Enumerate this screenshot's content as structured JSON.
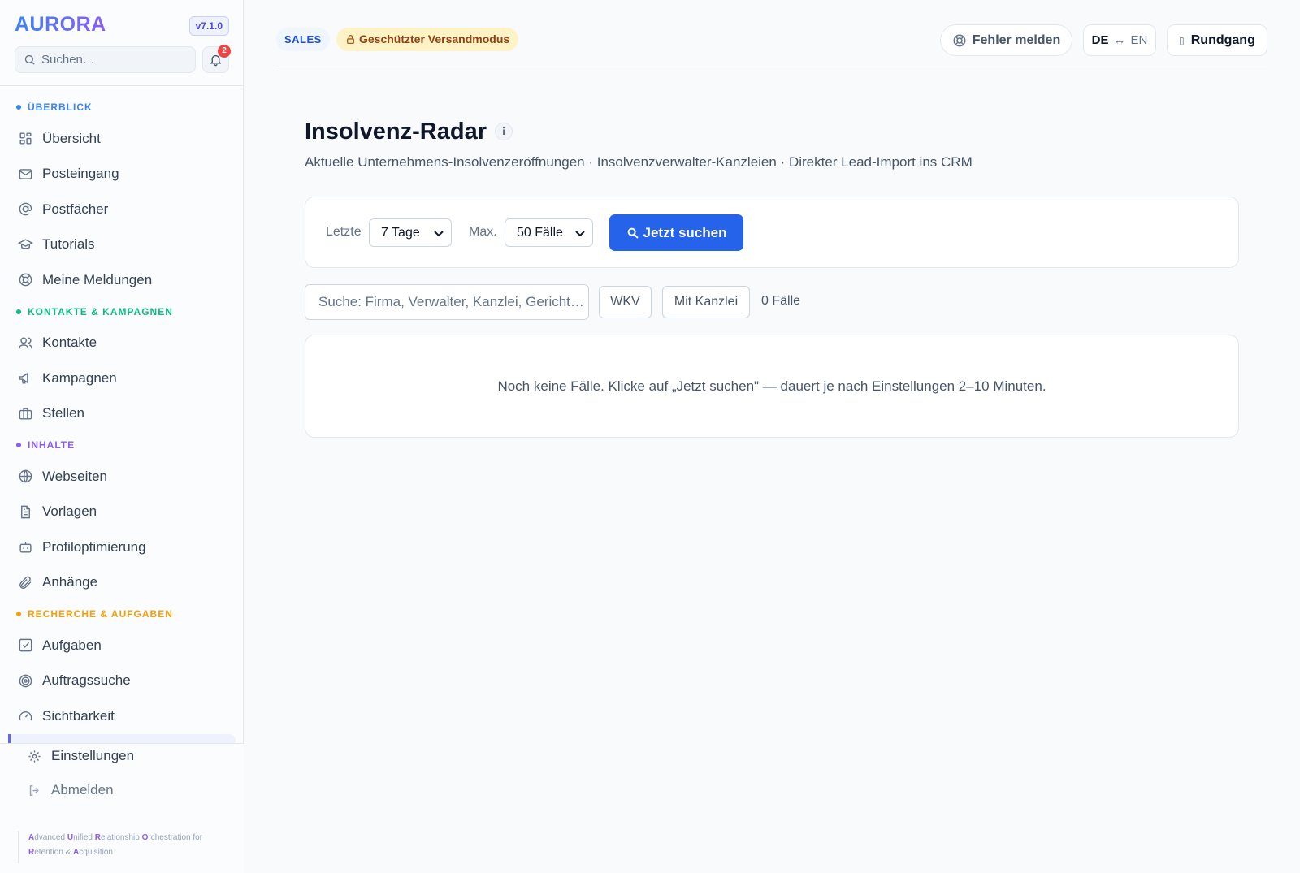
{
  "app": {
    "name": "AURORA",
    "version": "v7.1.0"
  },
  "sidebar": {
    "search_placeholder": "Suchen…",
    "notification_count": "2",
    "sections": [
      {
        "label": "ÜBERBLICK",
        "color": "#3b82f6",
        "items": [
          {
            "label": "Übersicht",
            "icon": "grid-icon"
          },
          {
            "label": "Posteingang",
            "icon": "mail-icon"
          },
          {
            "label": "Postfächer",
            "icon": "at-icon"
          },
          {
            "label": "Tutorials",
            "icon": "graduation-cap-icon"
          },
          {
            "label": "Meine Meldungen",
            "icon": "lifebuoy-icon"
          }
        ]
      },
      {
        "label": "KONTAKTE & KAMPAGNEN",
        "color": "#10b981",
        "items": [
          {
            "label": "Kontakte",
            "icon": "users-icon"
          },
          {
            "label": "Kampagnen",
            "icon": "megaphone-icon"
          },
          {
            "label": "Stellen",
            "icon": "briefcase-icon"
          }
        ]
      },
      {
        "label": "INHALTE",
        "color": "#8b5cf6",
        "items": [
          {
            "label": "Webseiten",
            "icon": "globe-icon"
          },
          {
            "label": "Vorlagen",
            "icon": "document-icon"
          },
          {
            "label": "Profiloptimierung",
            "icon": "bot-icon"
          },
          {
            "label": "Anhänge",
            "icon": "paperclip-icon"
          }
        ]
      },
      {
        "label": "RECHERCHE & AUFGABEN",
        "color": "#f59e0b",
        "items": [
          {
            "label": "Aufgaben",
            "icon": "checkbox-icon"
          },
          {
            "label": "Auftragssuche",
            "icon": "target-icon"
          },
          {
            "label": "Sichtbarkeit",
            "icon": "gauge-icon"
          }
        ]
      }
    ],
    "settings_label": "Einstellungen",
    "logout_label": "Abmelden",
    "tagline": [
      {
        "b": "A",
        "t": "dvanced "
      },
      {
        "b": "U",
        "t": "nified "
      },
      {
        "b": "R",
        "t": "elationship "
      },
      {
        "b": "O",
        "t": "rchestration for "
      },
      {
        "b": "R",
        "t": "etention & "
      },
      {
        "b": "A",
        "t": "cquisition"
      }
    ]
  },
  "topbar": {
    "mode_badge": "SALES",
    "safe_mode_badge": "Geschützter Versandmodus",
    "report_error_label": "Fehler melden",
    "lang_de": "DE",
    "lang_arrow": "↔",
    "lang_en": "EN",
    "tour_glyph": "▯",
    "tour_label": "Rundgang"
  },
  "main": {
    "title": "Insolvenz-Radar",
    "info_glyph": "i",
    "subtitle": "Aktuelle Unternehmens-Insolvenzeröffnungen · Insolvenzverwalter-Kanzleien · Direkter Lead-Import ins CRM",
    "filter": {
      "period_label": "Letzte",
      "period_value": "7 Tage",
      "max_label": "Max.",
      "max_value": "50 Fälle",
      "search_button": "Jetzt suchen"
    },
    "list_filter": {
      "search_placeholder": "Suche: Firma, Verwalter, Kanzlei, Gericht…",
      "chip_wkv": "WKV",
      "chip_kanzlei": "Mit Kanzlei",
      "count": "0 Fälle"
    },
    "empty_state": "Noch keine Fälle. Klicke auf „Jetzt suchen\" — dauert je nach Einstellungen 2–10 Minuten."
  },
  "colors": {
    "accent": "#2563eb",
    "brand_from": "#3b82f6",
    "brand_to": "#8b5cf6"
  }
}
